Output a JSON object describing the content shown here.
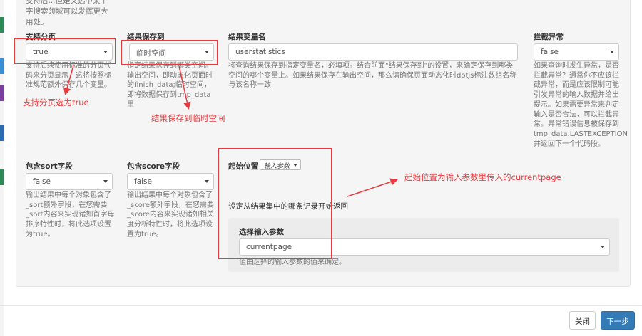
{
  "top_help": "支持后...但是文选中某个字搜索领域可以发挥更大用处。",
  "fields": {
    "paging": {
      "label": "支持分页",
      "value": "true",
      "help": "支持后续使用标准的分页代码来分页显示，这将按照标准规范额外保存几个变量。"
    },
    "save_to": {
      "label": "结果保存到",
      "value": "临时空间",
      "help": "指定结果保存到哪类空间。输出空间，即动态化页面时的finish_data;临时空间，即将数据保存到tmp_data里"
    },
    "result_var": {
      "label": "结果变量名",
      "value": "userstatistics",
      "help": "将查询结果保存到指定变量名，必填项。结合前面\"结果保存到\"的设置，来确定保存到哪类空间的哪个变量上。如果结果保存在输出空间，那么请确保页面动态化时dotjs标注数组名称与该名称一致"
    },
    "intercept": {
      "label": "拦截异常",
      "value": "false",
      "help": "如果查询时发生异常，是否拦截异常？通常你不应该拦截异常，而是应该限制可能引发异常的输入数据并给出提示。如果需要异常来判定输入是否合法，可以拦截异常。异常错误信息被保存到tmp_data.LASTEXCEPTION并返回下一个代码段。"
    },
    "sort": {
      "label": "包含sort字段",
      "value": "false",
      "help": "输出结果中每个对象包含了_sort额外字段，在您需要_sort内容来实现诸如首字母排序特性时，将此选项设置为true。"
    },
    "score": {
      "label": "包含score字段",
      "value": "false",
      "help": "输出结果中每个对象包含了_score额外字段，在您需要_score内容来实现诸如相关度分析特性时，将此选项设置为true。"
    },
    "start": {
      "label": "起始位置",
      "mode": "输入参数",
      "desc": "设定从结果集中的哪条记录开始返回",
      "sub_label": "选择输入参数",
      "sub_value": "currentpage",
      "sub_help": "值由选择的输入参数的值来确定。"
    }
  },
  "annotations": {
    "paging": "支持分页选为true",
    "save_to": "结果保存到临时空间",
    "start": "起始位置为输入参数里传入的currentpage"
  },
  "buttons": {
    "close": "关闭",
    "next": "下一步"
  },
  "colors": {
    "annotation": "#e8393d",
    "primary": "#337ab7",
    "panel": "#f5f5f5"
  }
}
